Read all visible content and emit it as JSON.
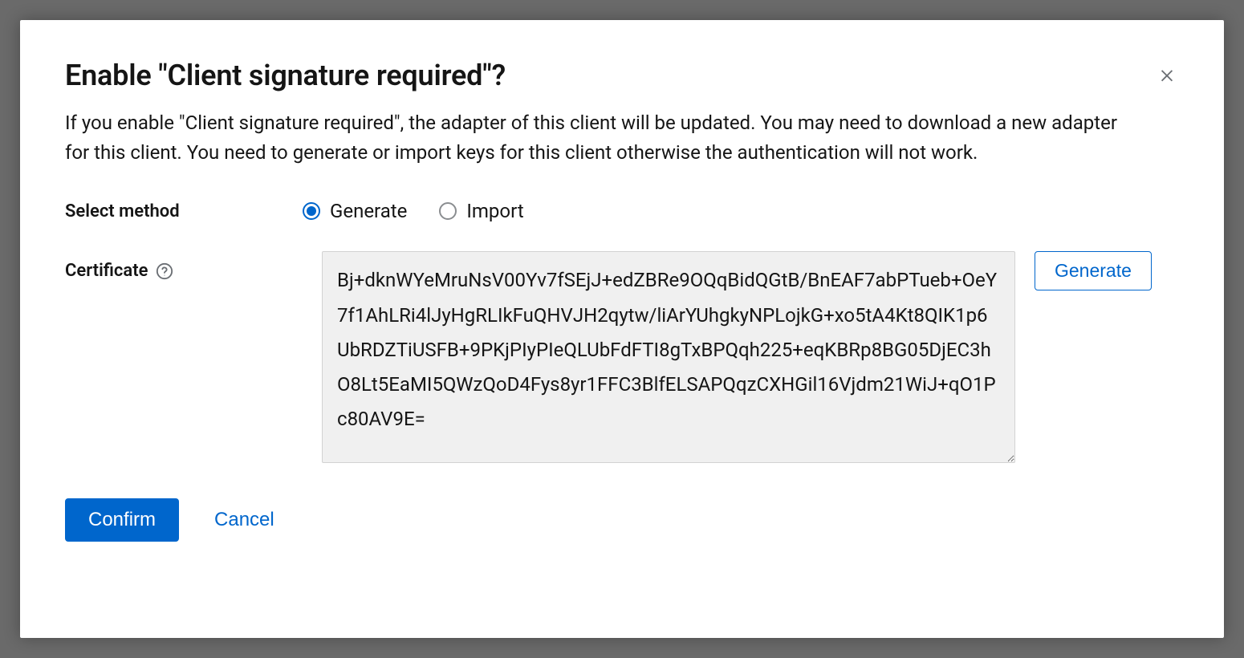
{
  "modal": {
    "title": "Enable \"Client signature required\"?",
    "description": "If you enable \"Client signature required\", the adapter of this client will be updated. You may need to download a new adapter for this client. You need to generate or import keys for this client otherwise the authentication will not work."
  },
  "form": {
    "select_method_label": "Select method",
    "radio_generate": "Generate",
    "radio_import": "Import",
    "selected_method": "generate",
    "certificate_label": "Certificate",
    "certificate_value": "Bj+dknWYeMruNsV00Yv7fSEjJ+edZBRe9OQqBidQGtB/BnEAF7abPTueb+OeY7f1AhLRi4lJyHgRLIkFuQHVJH2qytw/liArYUhgkyNPLojkG+xo5tA4Kt8QIK1p6UbRDZTiUSFB+9PKjPIyPIeQLUbFdFTI8gTxBPQqh225+eqKBRp8BG05DjEC3hO8Lt5EaMI5QWzQoD4Fys8yr1FFC3BlfELSAPQqzCXHGil16Vjdm21WiJ+qO1Pc80AV9E=",
    "generate_button": "Generate"
  },
  "footer": {
    "confirm": "Confirm",
    "cancel": "Cancel"
  }
}
